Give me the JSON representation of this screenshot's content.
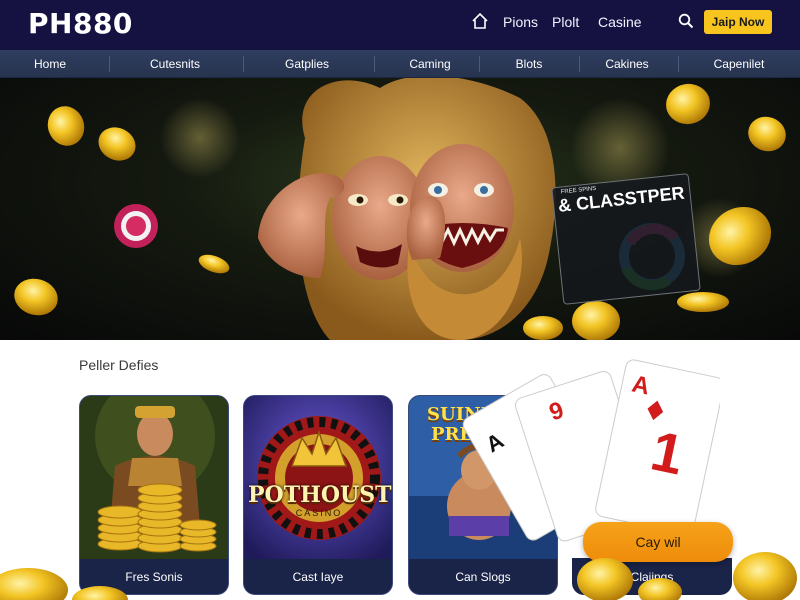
{
  "header": {
    "logo": "PH880",
    "nav": [
      "Pions",
      "Plolt",
      "Casine"
    ],
    "join_label": "Jaip Now",
    "icons": [
      "home-icon",
      "search-icon"
    ],
    "background_color": "#151141",
    "accent_color": "#f7c51e"
  },
  "categories": [
    "Home",
    "Cutesnits",
    "Gatplies",
    "Caming",
    "Blots",
    "Cakines",
    "Capenilet"
  ],
  "hero": {
    "promo_small": "FREE SPINS",
    "promo_title": "& CLASSTPER"
  },
  "section": {
    "title": "Peller Defies"
  },
  "cards": [
    {
      "label": "Fres Sonis",
      "art": "gladiator-coins"
    },
    {
      "label": "Cast Iaye",
      "art_title": "POTHOUST",
      "art_subtitle": "CASINO"
    },
    {
      "label": "Can Slogs",
      "art_title": "SUINEU",
      "art_subtitle": "PRES"
    },
    {
      "label": "Claiings"
    }
  ],
  "cta": {
    "label": "Cay wil",
    "color": "#f39a14"
  },
  "playing_cards": [
    "A",
    "9",
    "A",
    "1"
  ]
}
